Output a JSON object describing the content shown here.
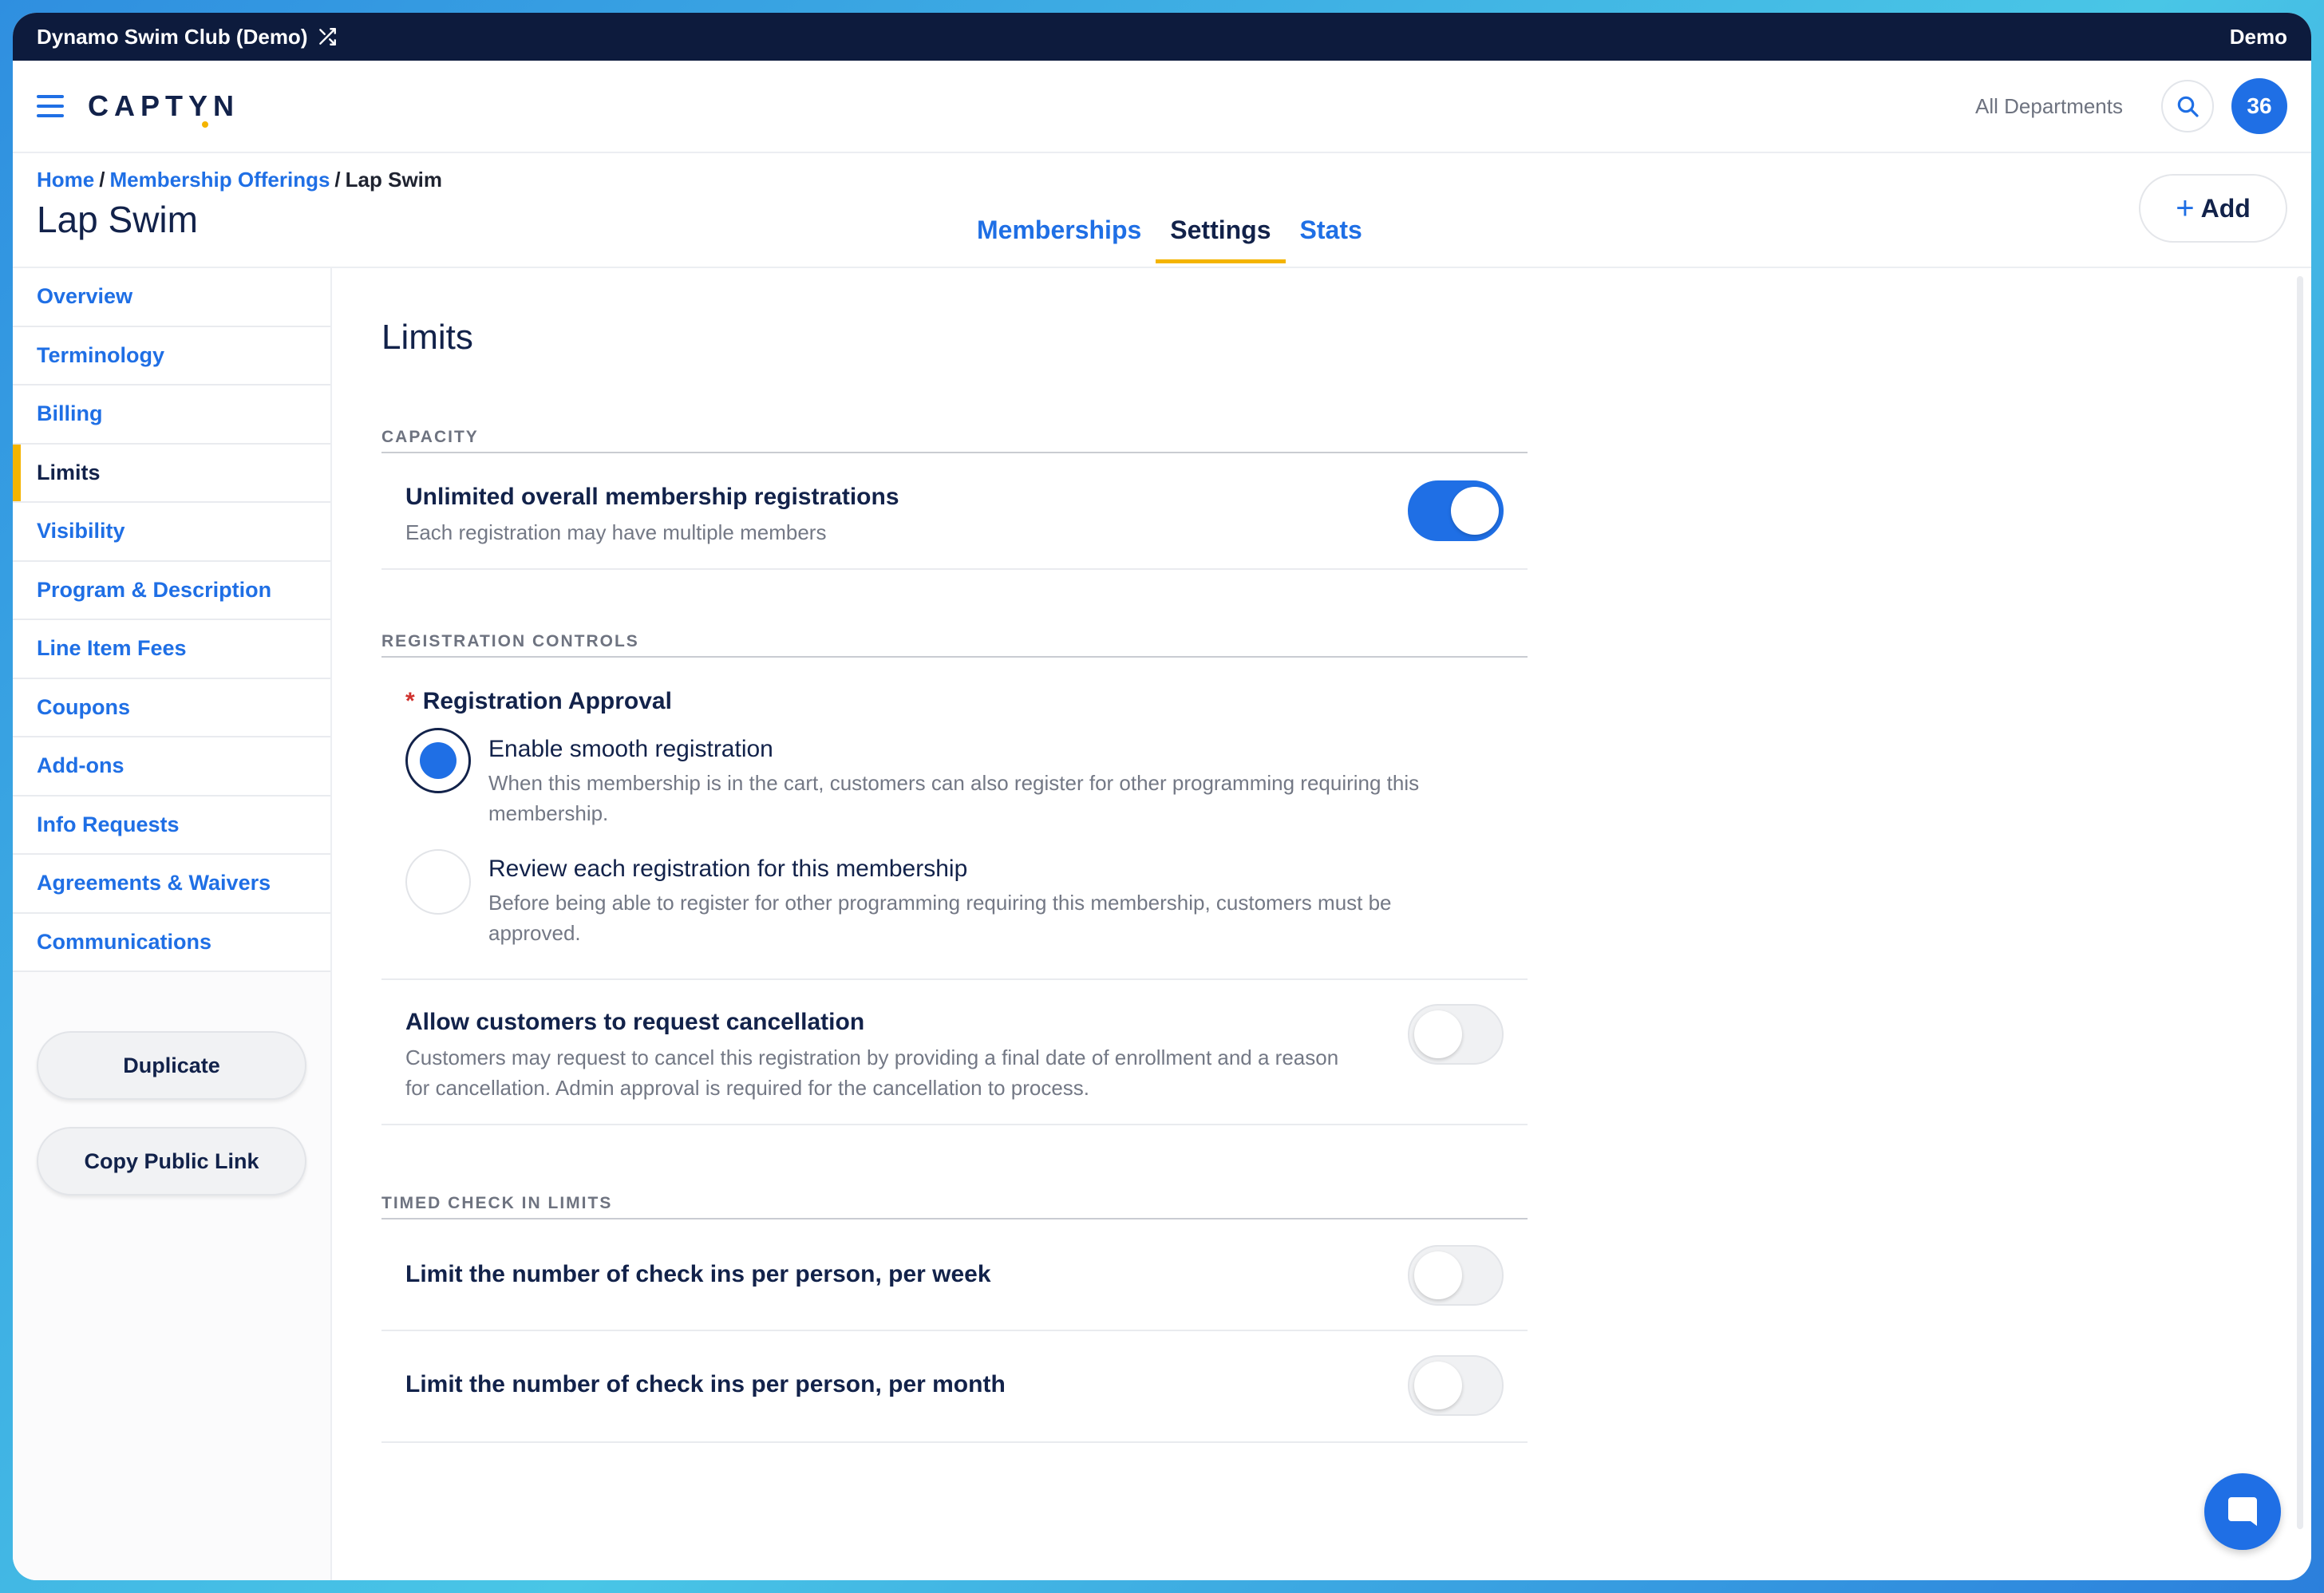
{
  "topbar": {
    "org_name": "Dynamo Swim Club (Demo)",
    "right_label": "Demo"
  },
  "header": {
    "logo": "CAPTYN",
    "department": "All Departments",
    "avatar": "36"
  },
  "breadcrumb": {
    "home": "Home",
    "offerings": "Membership Offerings",
    "current": "Lap Swim",
    "separator": "/"
  },
  "page": {
    "title": "Lap Swim",
    "add_label": "Add"
  },
  "tabs": [
    {
      "label": "Memberships",
      "active": false
    },
    {
      "label": "Settings",
      "active": true
    },
    {
      "label": "Stats",
      "active": false
    }
  ],
  "sidebar": {
    "items": [
      {
        "label": "Overview"
      },
      {
        "label": "Terminology"
      },
      {
        "label": "Billing"
      },
      {
        "label": "Limits"
      },
      {
        "label": "Visibility"
      },
      {
        "label": "Program & Description"
      },
      {
        "label": "Line Item Fees"
      },
      {
        "label": "Coupons"
      },
      {
        "label": "Add-ons"
      },
      {
        "label": "Info Requests"
      },
      {
        "label": "Agreements & Waivers"
      },
      {
        "label": "Communications"
      }
    ],
    "active_index": 3,
    "duplicate_label": "Duplicate",
    "copy_link_label": "Copy Public Link"
  },
  "limits": {
    "heading": "Limits",
    "capacity": {
      "section": "CAPACITY",
      "unlimited_title": "Unlimited overall membership registrations",
      "unlimited_desc": "Each registration may have multiple members",
      "unlimited_on": true
    },
    "registration_controls": {
      "section": "REGISTRATION CONTROLS",
      "approval_label": "Registration Approval",
      "required_mark": "*",
      "options": [
        {
          "title": "Enable smooth registration",
          "desc": "When this membership is in the cart, customers can also register for other programming requiring this membership.",
          "checked": true
        },
        {
          "title": "Review each registration for this membership",
          "desc": "Before being able to register for other programming requiring this membership, customers must be approved.",
          "checked": false
        }
      ],
      "cancellation_title": "Allow customers to request cancellation",
      "cancellation_desc": "Customers may request to cancel this registration by providing a final date of enrollment and a reason for cancellation. Admin approval is required for the cancellation to process.",
      "cancellation_on": false
    },
    "timed": {
      "section": "TIMED CHECK IN LIMITS",
      "week_title": "Limit the number of check ins per person, per week",
      "week_on": false,
      "month_title": "Limit the number of check ins per person, per month",
      "month_on": false
    }
  },
  "colors": {
    "accent": "#1f6fe5",
    "navy": "#0d1b3d",
    "highlight": "#f4b400"
  },
  "icons": {
    "menu": "hamburger-icon",
    "search": "search-icon",
    "shuffle": "shuffle-icon",
    "chat": "chat-icon",
    "add": "plus-icon"
  }
}
